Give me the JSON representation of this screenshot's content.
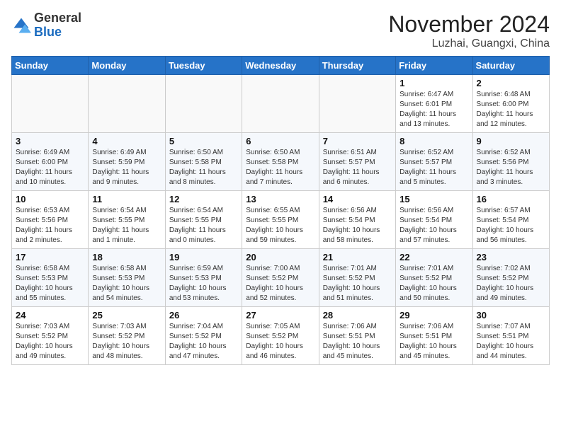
{
  "logo": {
    "general": "General",
    "blue": "Blue"
  },
  "title": "November 2024",
  "location": "Luzhai, Guangxi, China",
  "days_header": [
    "Sunday",
    "Monday",
    "Tuesday",
    "Wednesday",
    "Thursday",
    "Friday",
    "Saturday"
  ],
  "weeks": [
    [
      {
        "num": "",
        "info": ""
      },
      {
        "num": "",
        "info": ""
      },
      {
        "num": "",
        "info": ""
      },
      {
        "num": "",
        "info": ""
      },
      {
        "num": "",
        "info": ""
      },
      {
        "num": "1",
        "info": "Sunrise: 6:47 AM\nSunset: 6:01 PM\nDaylight: 11 hours and 13 minutes."
      },
      {
        "num": "2",
        "info": "Sunrise: 6:48 AM\nSunset: 6:00 PM\nDaylight: 11 hours and 12 minutes."
      }
    ],
    [
      {
        "num": "3",
        "info": "Sunrise: 6:49 AM\nSunset: 6:00 PM\nDaylight: 11 hours and 10 minutes."
      },
      {
        "num": "4",
        "info": "Sunrise: 6:49 AM\nSunset: 5:59 PM\nDaylight: 11 hours and 9 minutes."
      },
      {
        "num": "5",
        "info": "Sunrise: 6:50 AM\nSunset: 5:58 PM\nDaylight: 11 hours and 8 minutes."
      },
      {
        "num": "6",
        "info": "Sunrise: 6:50 AM\nSunset: 5:58 PM\nDaylight: 11 hours and 7 minutes."
      },
      {
        "num": "7",
        "info": "Sunrise: 6:51 AM\nSunset: 5:57 PM\nDaylight: 11 hours and 6 minutes."
      },
      {
        "num": "8",
        "info": "Sunrise: 6:52 AM\nSunset: 5:57 PM\nDaylight: 11 hours and 5 minutes."
      },
      {
        "num": "9",
        "info": "Sunrise: 6:52 AM\nSunset: 5:56 PM\nDaylight: 11 hours and 3 minutes."
      }
    ],
    [
      {
        "num": "10",
        "info": "Sunrise: 6:53 AM\nSunset: 5:56 PM\nDaylight: 11 hours and 2 minutes."
      },
      {
        "num": "11",
        "info": "Sunrise: 6:54 AM\nSunset: 5:55 PM\nDaylight: 11 hours and 1 minute."
      },
      {
        "num": "12",
        "info": "Sunrise: 6:54 AM\nSunset: 5:55 PM\nDaylight: 11 hours and 0 minutes."
      },
      {
        "num": "13",
        "info": "Sunrise: 6:55 AM\nSunset: 5:55 PM\nDaylight: 10 hours and 59 minutes."
      },
      {
        "num": "14",
        "info": "Sunrise: 6:56 AM\nSunset: 5:54 PM\nDaylight: 10 hours and 58 minutes."
      },
      {
        "num": "15",
        "info": "Sunrise: 6:56 AM\nSunset: 5:54 PM\nDaylight: 10 hours and 57 minutes."
      },
      {
        "num": "16",
        "info": "Sunrise: 6:57 AM\nSunset: 5:54 PM\nDaylight: 10 hours and 56 minutes."
      }
    ],
    [
      {
        "num": "17",
        "info": "Sunrise: 6:58 AM\nSunset: 5:53 PM\nDaylight: 10 hours and 55 minutes."
      },
      {
        "num": "18",
        "info": "Sunrise: 6:58 AM\nSunset: 5:53 PM\nDaylight: 10 hours and 54 minutes."
      },
      {
        "num": "19",
        "info": "Sunrise: 6:59 AM\nSunset: 5:53 PM\nDaylight: 10 hours and 53 minutes."
      },
      {
        "num": "20",
        "info": "Sunrise: 7:00 AM\nSunset: 5:52 PM\nDaylight: 10 hours and 52 minutes."
      },
      {
        "num": "21",
        "info": "Sunrise: 7:01 AM\nSunset: 5:52 PM\nDaylight: 10 hours and 51 minutes."
      },
      {
        "num": "22",
        "info": "Sunrise: 7:01 AM\nSunset: 5:52 PM\nDaylight: 10 hours and 50 minutes."
      },
      {
        "num": "23",
        "info": "Sunrise: 7:02 AM\nSunset: 5:52 PM\nDaylight: 10 hours and 49 minutes."
      }
    ],
    [
      {
        "num": "24",
        "info": "Sunrise: 7:03 AM\nSunset: 5:52 PM\nDaylight: 10 hours and 49 minutes."
      },
      {
        "num": "25",
        "info": "Sunrise: 7:03 AM\nSunset: 5:52 PM\nDaylight: 10 hours and 48 minutes."
      },
      {
        "num": "26",
        "info": "Sunrise: 7:04 AM\nSunset: 5:52 PM\nDaylight: 10 hours and 47 minutes."
      },
      {
        "num": "27",
        "info": "Sunrise: 7:05 AM\nSunset: 5:52 PM\nDaylight: 10 hours and 46 minutes."
      },
      {
        "num": "28",
        "info": "Sunrise: 7:06 AM\nSunset: 5:51 PM\nDaylight: 10 hours and 45 minutes."
      },
      {
        "num": "29",
        "info": "Sunrise: 7:06 AM\nSunset: 5:51 PM\nDaylight: 10 hours and 45 minutes."
      },
      {
        "num": "30",
        "info": "Sunrise: 7:07 AM\nSunset: 5:51 PM\nDaylight: 10 hours and 44 minutes."
      }
    ]
  ]
}
